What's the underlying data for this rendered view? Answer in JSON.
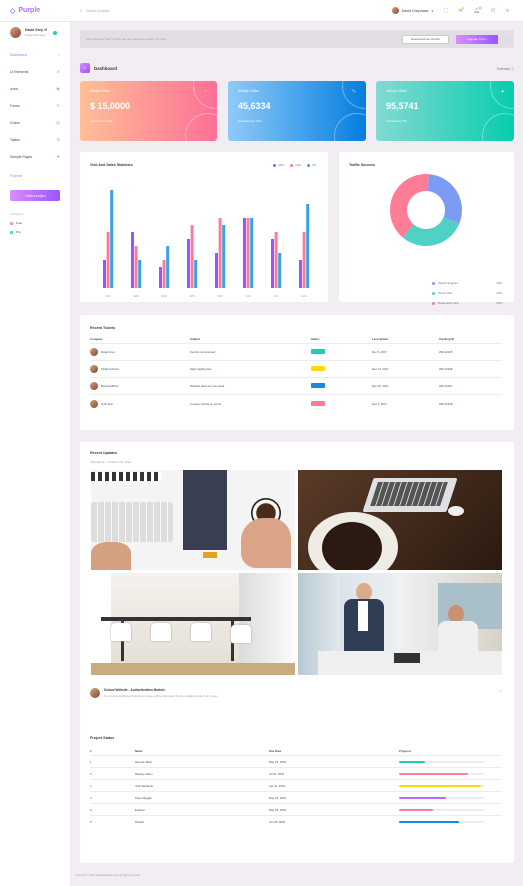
{
  "brand": {
    "name": "Purple",
    "accent": "#b66dff"
  },
  "topbar": {
    "search_placeholder": "Search projects",
    "user_name": "David Greymaax"
  },
  "sidebar": {
    "profile_name": "David Grey. H",
    "profile_role": "Project Manager",
    "items": [
      {
        "label": "Dashboard",
        "icon": "home-icon"
      },
      {
        "label": "UI Elements",
        "icon": "crosshairs-icon"
      },
      {
        "label": "Icons",
        "icon": "contacts-icon"
      },
      {
        "label": "Forms",
        "icon": "format-list-icon"
      },
      {
        "label": "Charts",
        "icon": "chart-bar-icon"
      },
      {
        "label": "Tables",
        "icon": "table-icon"
      },
      {
        "label": "Sample Pages",
        "icon": "medical-bag-icon"
      }
    ],
    "projects_label": "Projects",
    "add_project": "+ Add a project",
    "categories_title": "Categories",
    "categories": [
      {
        "label": "Free",
        "color": "#fe7c96"
      },
      {
        "label": "Pro",
        "color": "#1bcfb4"
      }
    ]
  },
  "banner": {
    "text": "Like what you see? Check out our premium version for more.",
    "download_btn": "Download Free Version",
    "upgrade_btn": "Upgrade To Pro",
    "close": "×"
  },
  "page": {
    "title": "Dashboard",
    "overview": "Overview ⓘ"
  },
  "stats": [
    {
      "label": "Weekly Sales",
      "value": "$ 15,0000",
      "sub": "Increased by 60%",
      "icon": "chart-line-icon"
    },
    {
      "label": "Weekly Orders",
      "value": "45,6334",
      "sub": "Decreased by 10%",
      "icon": "bookmark-icon"
    },
    {
      "label": "Visitors Online",
      "value": "95,5741",
      "sub": "Increased by 5%",
      "icon": "diamond-icon"
    }
  ],
  "visit_chart": {
    "title": "Visit And Sales Statistics",
    "legend": [
      "CHN",
      "USA",
      "UK"
    ]
  },
  "chart_data": {
    "type": "bar",
    "categories": [
      "JAN",
      "FEB",
      "MAR",
      "APR",
      "MAY",
      "JUN",
      "JUL",
      "AUG"
    ],
    "series": [
      {
        "name": "CHN",
        "color": "#9a55ff",
        "values": [
          20,
          40,
          15,
          35,
          25,
          50,
          35,
          20
        ]
      },
      {
        "name": "USA",
        "color": "#fe7c96",
        "values": [
          40,
          30,
          20,
          45,
          50,
          50,
          40,
          40
        ]
      },
      {
        "name": "UK",
        "color": "#36a2eb",
        "values": [
          70,
          20,
          30,
          20,
          45,
          50,
          25,
          60
        ]
      }
    ],
    "ylim": [
      0,
      70
    ]
  },
  "traffic": {
    "title": "Traffic Sources",
    "sources": [
      {
        "label": "Search Engines",
        "value": 30,
        "pct": "30%",
        "color": "#7c9cf3"
      },
      {
        "label": "Direct Click",
        "value": 30,
        "pct": "30%",
        "color": "#4fd1c5"
      },
      {
        "label": "Bookmarks Click",
        "value": 40,
        "pct": "40%",
        "color": "#fe7c96"
      }
    ]
  },
  "tickets": {
    "title": "Recent Tickets",
    "headers": [
      "Assignee",
      "Subject",
      "Status",
      "Last Update",
      "Tracking ID"
    ],
    "rows": [
      {
        "name": "David Grey",
        "subject": "Fund is not recieved",
        "status": "DONE",
        "status_color": "#1bcfb4",
        "date": "Dec 5, 2017",
        "id": "WD-12345"
      },
      {
        "name": "Stella Johnson",
        "subject": "High loading time",
        "status": "PROGRESS",
        "status_color": "#fed713",
        "date": "Dec 12, 2017",
        "id": "WD-12346"
      },
      {
        "name": "Marina Michel",
        "subject": "Website down for one week",
        "status": "ON HOLD",
        "status_color": "#198ae3",
        "date": "Dec 16, 2017",
        "id": "WD-12347"
      },
      {
        "name": "John Doe",
        "subject": "Loosing control on server",
        "status": "REJECTED",
        "status_color": "#fe7c96",
        "date": "Dec 3, 2017",
        "id": "WD-12348"
      }
    ]
  },
  "updates": {
    "title": "Recent Updates",
    "meta": "Jack Menqu   ○ October 3rd, 2018",
    "post_title": "School Website - Authentication Module.",
    "post_text": "It is a long established fact that a reader will be distracted by the readable content of a page."
  },
  "project_status": {
    "title": "Project Status",
    "headers": [
      "#",
      "Name",
      "Due Date",
      "Progress"
    ],
    "rows": [
      {
        "n": "1",
        "name": "Herman Beck",
        "due": "May 15, 2015",
        "progress": 0.3,
        "color": "#1bcfb4"
      },
      {
        "n": "2",
        "name": "Messsy Adam",
        "due": "Jul 01, 2015",
        "progress": 0.8,
        "color": "#fe7c96"
      },
      {
        "n": "3",
        "name": "John Richards",
        "due": "Apr 12, 2015",
        "progress": 0.95,
        "color": "#fed713"
      },
      {
        "n": "4",
        "name": "Peter Meggik",
        "due": "May 15, 2015",
        "progress": 0.55,
        "color": "#b66dff"
      },
      {
        "n": "5",
        "name": "Edward",
        "due": "May 03, 2015",
        "progress": 0.4,
        "color": "#fe7c96"
      },
      {
        "n": "5",
        "name": "Ronald",
        "due": "Jun 05, 2015",
        "progress": 0.7,
        "color": "#198ae3"
      }
    ]
  },
  "footer": "Copyright © 2018 bootstrapdash.com. All rights reserved."
}
